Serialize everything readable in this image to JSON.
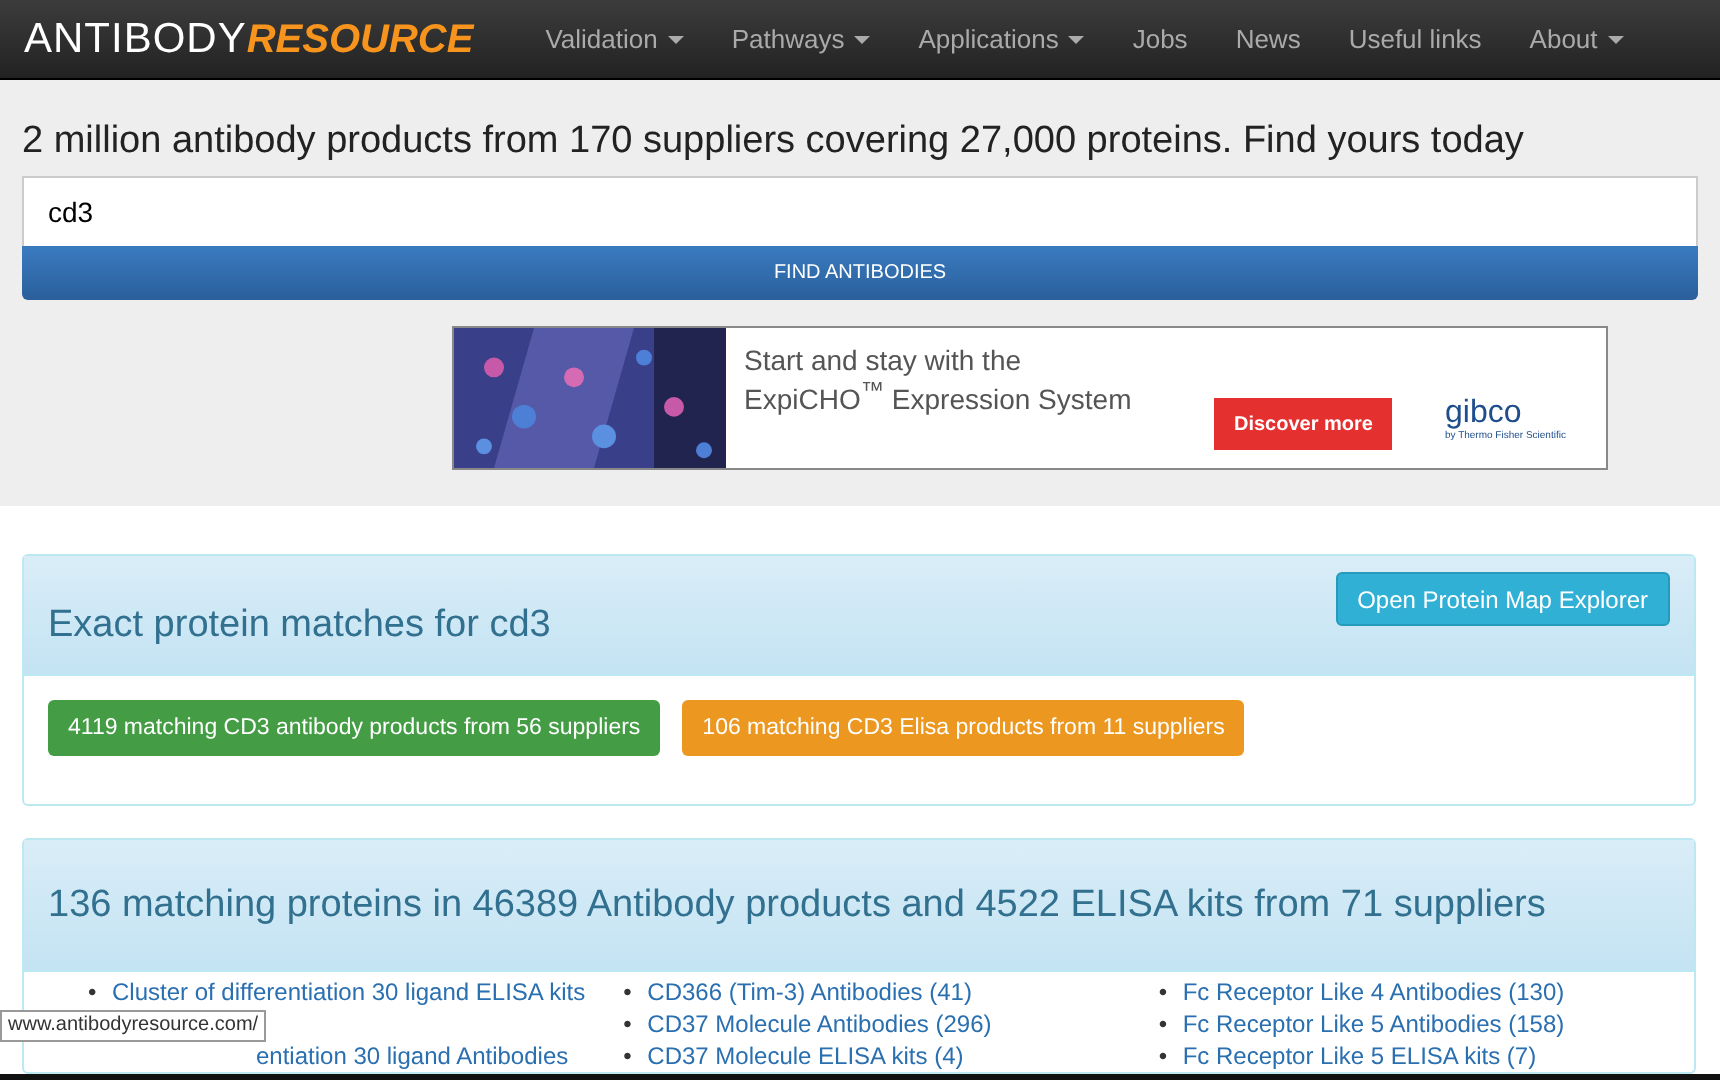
{
  "navbar": {
    "logo": {
      "main": "ANTIBODY",
      "accent": "RESOURCE"
    },
    "items": [
      {
        "label": "Validation",
        "dropdown": true
      },
      {
        "label": "Pathways",
        "dropdown": true
      },
      {
        "label": "Applications",
        "dropdown": true
      },
      {
        "label": "Jobs",
        "dropdown": false
      },
      {
        "label": "News",
        "dropdown": false
      },
      {
        "label": "Useful links",
        "dropdown": false
      },
      {
        "label": "About",
        "dropdown": true
      }
    ]
  },
  "search": {
    "heading": "2 million antibody products from 170 suppliers covering 27,000 proteins. Find yours today",
    "value": "cd3",
    "button": "FIND ANTIBODIES"
  },
  "ad": {
    "headline": "Start and stay with the",
    "subline": "ExpiCHO$^{™}$ Expression System",
    "button": "Discover more",
    "brand": "gibco",
    "brand_sub": "by Thermo Fisher Scientific"
  },
  "exact_matches": {
    "title": "Exact protein matches for cd3",
    "explorer_button": "Open Protein Map Explorer",
    "buttons": [
      {
        "label": "4119 matching CD3 antibody products from 56 suppliers",
        "color": "#449d44"
      },
      {
        "label": "106 matching CD3 Elisa products from 11 suppliers",
        "color": "#ec971f"
      }
    ]
  },
  "matching": {
    "title": "136 matching proteins in 46389 Antibody products and 4522 ELISA kits from 71 suppliers",
    "columns": [
      [
        {
          "kind": "item",
          "bullet": "•",
          "text": "Cluster of differentiation 30 ligand ELISA kits"
        },
        {
          "kind": "clipped",
          "text": "entiation 30 ligand Antibodies"
        }
      ],
      [
        {
          "kind": "item",
          "bullet": "•",
          "text": "CD366 (Tim-3) Antibodies (41)"
        },
        {
          "kind": "item",
          "bullet": "•",
          "text": "CD37 Molecule Antibodies (296)"
        },
        {
          "kind": "item",
          "bullet": "•",
          "text": "CD37 Molecule ELISA kits (4)"
        }
      ],
      [
        {
          "kind": "item",
          "bullet": "•",
          "text": "Fc Receptor Like 4 Antibodies (130)"
        },
        {
          "kind": "item",
          "bullet": "•",
          "text": "Fc Receptor Like 5 Antibodies (158)"
        },
        {
          "kind": "item",
          "bullet": "•",
          "text": "Fc Receptor Like 5 ELISA kits (7)"
        }
      ]
    ]
  },
  "status_bar": {
    "url": "www.antibodyresource.com/"
  }
}
